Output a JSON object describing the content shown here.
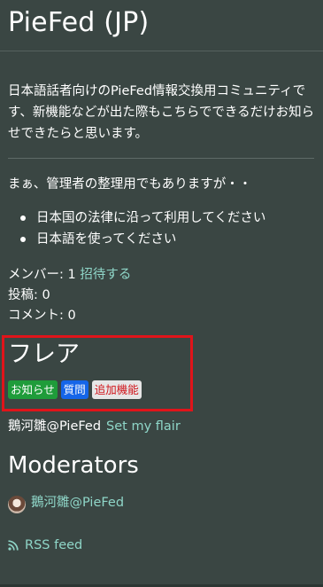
{
  "community": {
    "title": "PieFed (JP)",
    "description": "日本語話者向けのPieFed情報交換用コミュニティです、新機能などが出た際もこちらでできるだけお知らせできたらと思います。",
    "note": "まぁ、管理者の整理用でもありますが・・",
    "rules": [
      "日本国の法律に沿って利用してください",
      "日本語を使ってください"
    ]
  },
  "stats": {
    "members_label": "メンバー: 1",
    "invite_label": "招待する",
    "posts_label": "投稿: 0",
    "comments_label": "コメント: 0"
  },
  "flair": {
    "heading": "フレア",
    "tags": [
      {
        "label": "お知らせ",
        "bg": "#1f9c3a",
        "fg": "#ffffff"
      },
      {
        "label": "質問",
        "bg": "#1565e8",
        "fg": "#ffffff"
      },
      {
        "label": "追加機能",
        "bg": "#e6e6e6",
        "fg": "#d0141a"
      }
    ],
    "user": "鵝河雛@PieFed",
    "set_flair_label": "Set my flair",
    "highlight_color": "#e0141a"
  },
  "moderators": {
    "heading": "Moderators",
    "items": [
      {
        "name": "鵝河雛@PieFed",
        "icon": "avatar"
      }
    ]
  },
  "rss": {
    "label": "RSS feed",
    "icon": "rss-icon"
  },
  "colors": {
    "background": "#3a4643",
    "link": "#8fd6c8"
  }
}
